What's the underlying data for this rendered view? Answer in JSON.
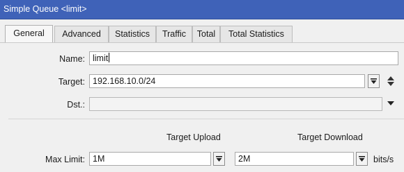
{
  "window": {
    "title": "Simple Queue <limit>"
  },
  "tabs": [
    "General",
    "Advanced",
    "Statistics",
    "Traffic",
    "Total",
    "Total Statistics"
  ],
  "form": {
    "name": {
      "label": "Name:",
      "value": "limit"
    },
    "target": {
      "label": "Target:",
      "value": "192.168.10.0/24"
    },
    "dst": {
      "label": "Dst.:",
      "value": ""
    },
    "headers": {
      "upload": "Target Upload",
      "download": "Target Download"
    },
    "max_limit": {
      "label": "Max Limit:",
      "upload": "1M",
      "download": "2M",
      "unit": "bits/s"
    }
  },
  "icons": {
    "dropdown": "dropdown-list-icon",
    "updown": "up-down-arrows-icon",
    "triangle": "triangle-down-icon"
  },
  "colors": {
    "titlebar": "#3f62b8",
    "window_bg": "#f0f0f0"
  }
}
